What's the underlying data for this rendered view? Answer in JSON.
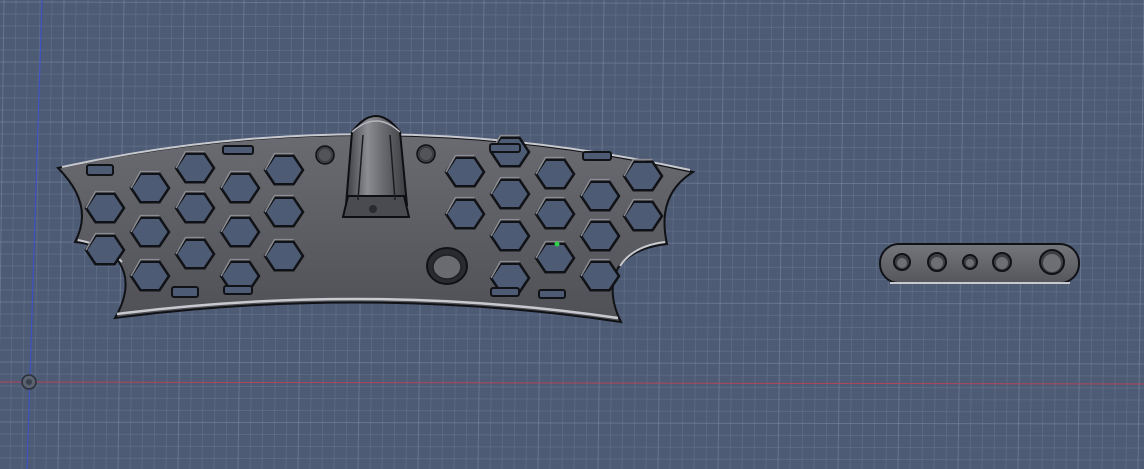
{
  "viewport": {
    "background_color": "#4d5b75",
    "grid_color": "#7f8aa1",
    "x_axis_color": "#b2455a",
    "y_axis_color": "#3a4fd2",
    "part_color": "#5d5e63",
    "part_edge_color": "#111216",
    "part_highlight_color": "#c7c9cf"
  },
  "scene": {
    "objects": [
      {
        "name": "honeycomb-plate",
        "icon": "hexagon-grid"
      },
      {
        "name": "link-bar",
        "icon": "rounded-bar-with-holes"
      }
    ],
    "origin_marker": {
      "icon": "origin-icon"
    }
  }
}
